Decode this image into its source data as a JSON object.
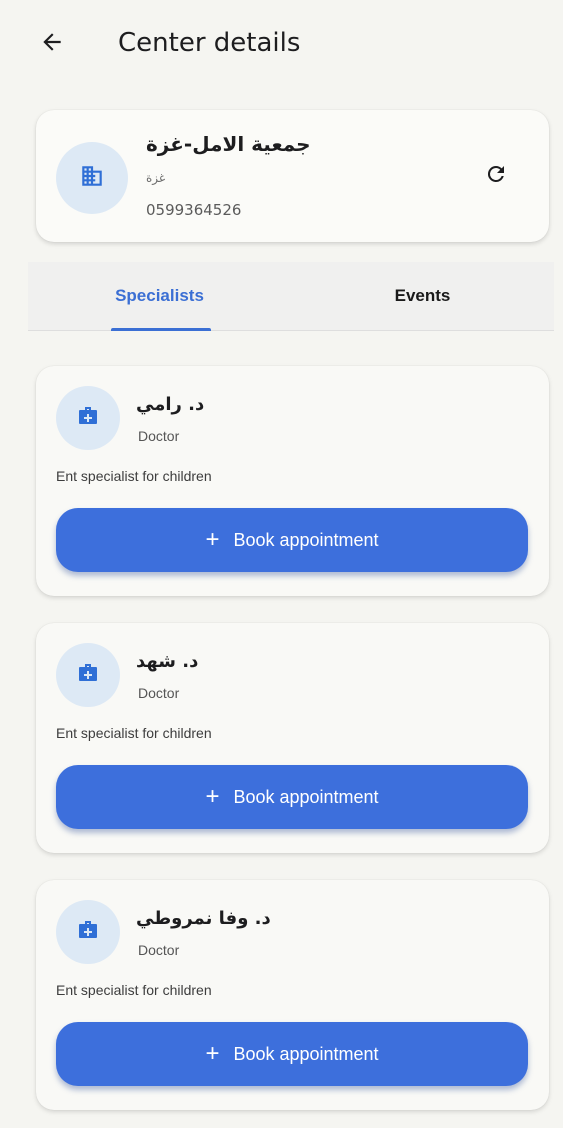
{
  "app_bar": {
    "title": "Center details"
  },
  "center": {
    "name": "جمعية الامل-غزة",
    "city": "غزة",
    "phone": "0599364526"
  },
  "tabs": [
    {
      "label": "Specialists",
      "selected": true
    },
    {
      "label": "Events",
      "selected": false
    }
  ],
  "specialists": [
    {
      "name": "د. رامي",
      "role": "Doctor",
      "description": "Ent specialist for children",
      "button_label": "Book appointment"
    },
    {
      "name": "د. شهد",
      "role": "Doctor",
      "description": "Ent specialist for children",
      "button_label": "Book appointment"
    },
    {
      "name": "د. وفا نمروطي",
      "role": "Doctor",
      "description": "Ent specialist for children",
      "button_label": "Book appointment"
    }
  ],
  "icons": {
    "back": "arrow-back-icon",
    "center": "building-icon",
    "refresh": "refresh-icon",
    "specialist": "medical-bag-icon",
    "book": "plus-icon"
  },
  "colors": {
    "accent": "#3d6fdc",
    "avatar_bg": "#dde9f5",
    "background": "#f5f5f1"
  }
}
